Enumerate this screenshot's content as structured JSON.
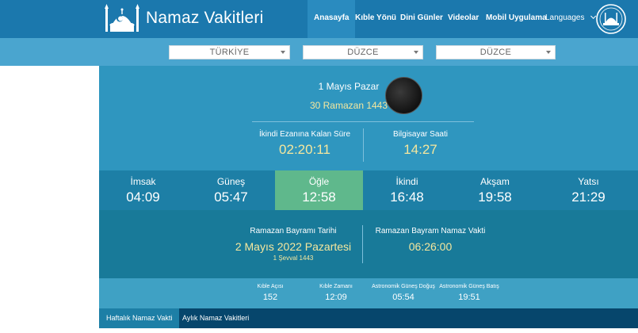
{
  "header": {
    "brand": "Namaz Vakitleri",
    "nav": [
      "Anasayfa",
      "Kıble Yönü",
      "Dini Günler",
      "Videolar",
      "Mobil Uygulama",
      "Languages"
    ],
    "active_nav": "Anasayfa"
  },
  "selectors": {
    "country": "TÜRKİYE",
    "city": "DÜZCE",
    "district": "DÜZCE"
  },
  "date": {
    "gregorian": "1 Mayıs Pazar",
    "hijri": "30 Ramazan 1443"
  },
  "countdown": {
    "label": "İkindi Ezanına Kalan Süre",
    "value": "02:20:11"
  },
  "clock": {
    "label": "Bilgisayar Saati",
    "value": "14:27"
  },
  "prayer_times": [
    {
      "name": "İmsak",
      "time": "04:09"
    },
    {
      "name": "Güneş",
      "time": "05:47"
    },
    {
      "name": "Öğle",
      "time": "12:58"
    },
    {
      "name": "İkindi",
      "time": "16:48"
    },
    {
      "name": "Akşam",
      "time": "19:58"
    },
    {
      "name": "Yatsı",
      "time": "21:29"
    }
  ],
  "current_prayer": "Öğle",
  "bayram": {
    "date_label": "Ramazan Bayramı Tarihi",
    "date_value": "2 Mayıs 2022 Pazartesi",
    "hijri_value": "1 Şevval 1443",
    "prayer_label": "Ramazan Bayram Namaz Vakti",
    "prayer_value": "06:26:00"
  },
  "stats": [
    {
      "label": "Kıble Açısı",
      "value": "152"
    },
    {
      "label": "Kıble Zamanı",
      "value": "12:09"
    },
    {
      "label": "Astronomik Güneş Doğuş",
      "value": "05:54"
    },
    {
      "label": "Astronomik Güneş Batış",
      "value": "19:51"
    }
  ],
  "tabs": [
    "Haftalık Namaz Vakti",
    "Aylık Namaz Vakitleri"
  ],
  "colors": {
    "header": "#1b78ad",
    "panel": "#2f96bf",
    "times_row": "#1d7fa6",
    "current": "#5fb88c",
    "accent_text": "#f5e79e",
    "tabs_bar": "#06466c"
  }
}
